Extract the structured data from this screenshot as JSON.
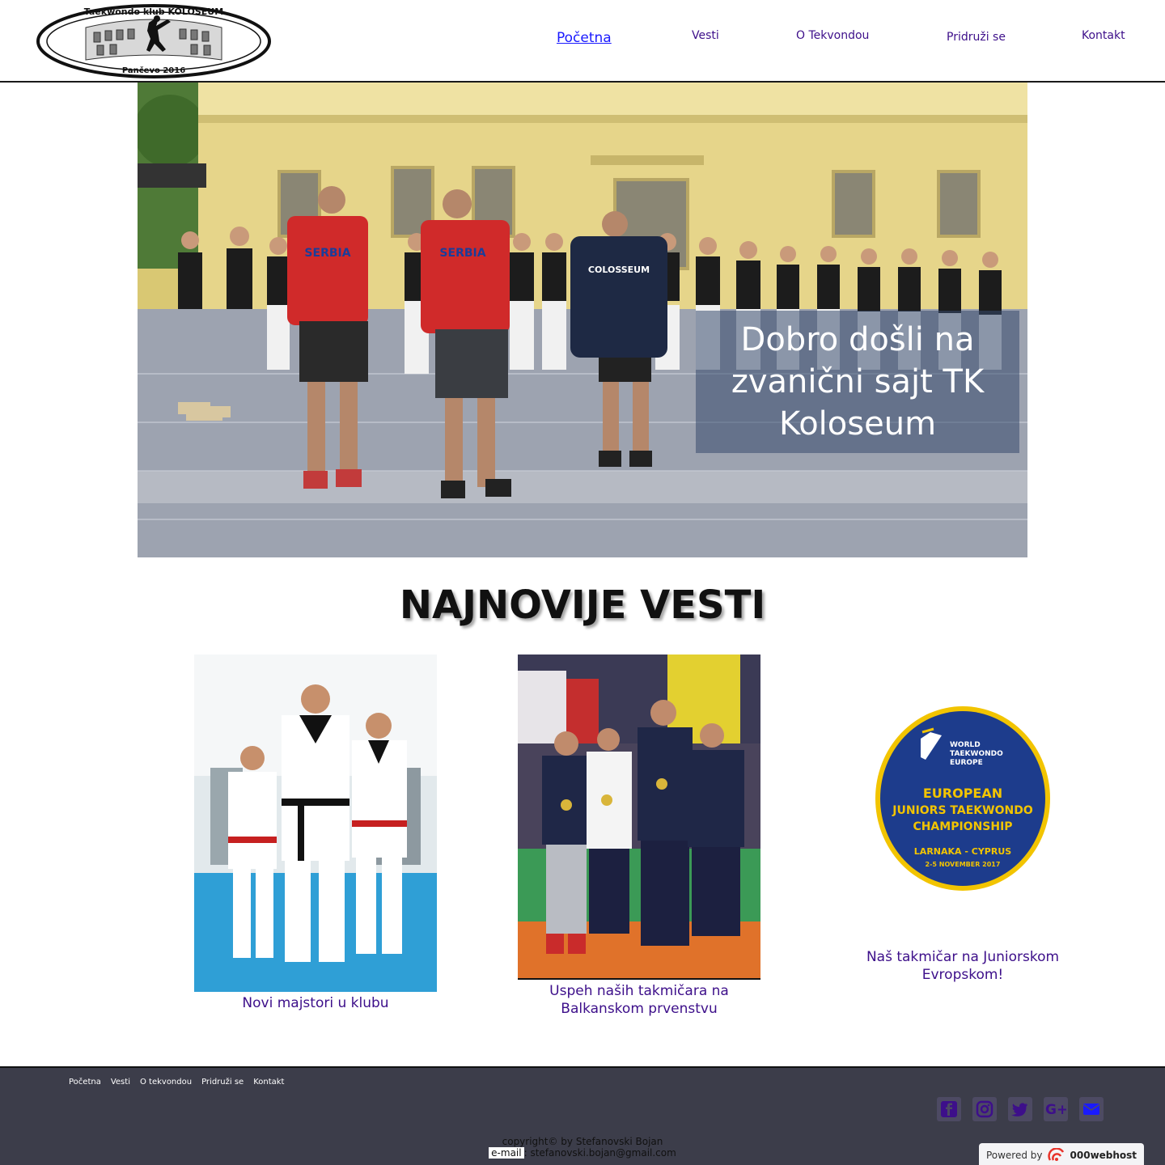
{
  "logo": {
    "top_text": "Taekwondo klub KOLOSEUM",
    "bottom_text": "Pančevo 2016"
  },
  "nav": {
    "items": [
      "Početna",
      "Vesti",
      "O Tekvondou",
      "Pridruži se",
      "Kontakt"
    ],
    "active": "Početna"
  },
  "hero": {
    "welcome": "Dobro došli na zvanični sajt TK Koloseum",
    "shirt_text": "SERBIA",
    "jacket_text": "COLOSSEUM"
  },
  "news": {
    "title": "NAJNOVIJE VESTI",
    "items": [
      {
        "caption": "Novi majstori u klubu"
      },
      {
        "caption": "Uspeh naših takmičara na Balkanskom prvenstvu"
      },
      {
        "caption": "Naš takmičar na Juniorskom Evropskom!"
      }
    ],
    "badge": {
      "line1": "WORLD",
      "line2": "TAEKWONDO",
      "line3": "EUROPE",
      "title1": "EUROPEAN",
      "title2": "JUNIORS TAEKWONDO",
      "title3": "CHAMPIONSHIP",
      "place": "LARNAKA - CYPRUS",
      "date": "2-5 NOVEMBER 2017"
    }
  },
  "footer": {
    "nav": [
      "Početna",
      "Vesti",
      "O tekvondou",
      "Pridruži se",
      "Kontakt"
    ],
    "copyright": "copyright© by Stefanovski Bojan",
    "email_label": "e-mail",
    "email": ": stefanovski.bojan@gmail.com",
    "social": [
      "facebook-icon",
      "instagram-icon",
      "twitter-icon",
      "google-plus-icon",
      "envelope-icon"
    ],
    "powered_by": "Powered by",
    "host": "000webhost"
  },
  "colors": {
    "nav_text": "#3d0f8a",
    "nav_active": "#1a1aff",
    "footer_bg": "#3c3d4a",
    "badge_blue": "#1d3c8c",
    "badge_gold": "#f2c400"
  }
}
